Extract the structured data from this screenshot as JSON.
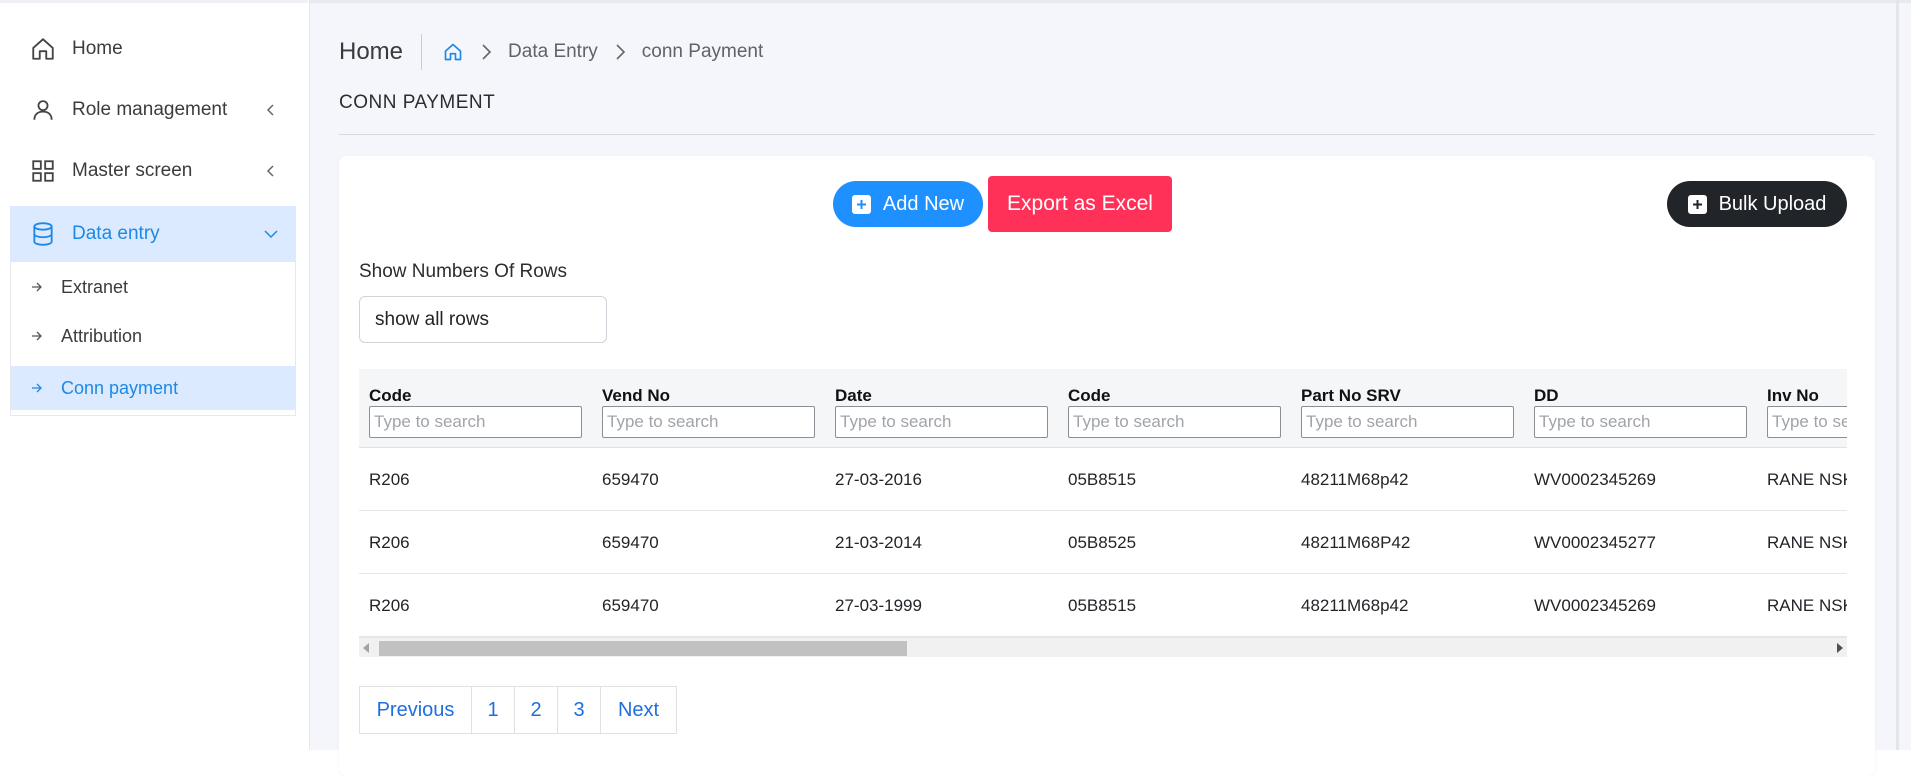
{
  "sidebar": {
    "items": [
      {
        "label": "Home",
        "icon": "home-icon"
      },
      {
        "label": "Role management",
        "icon": "user-icon"
      },
      {
        "label": "Master screen",
        "icon": "grid-icon"
      },
      {
        "label": "Data entry",
        "icon": "database-icon",
        "active": true
      }
    ],
    "subitems": [
      {
        "label": "Extranet"
      },
      {
        "label": "Attribution"
      },
      {
        "label": "Conn payment",
        "active": true
      }
    ]
  },
  "breadcrumb": {
    "title": "Home",
    "items": [
      "Data Entry",
      "conn Payment"
    ]
  },
  "page_title": "CONN PAYMENT",
  "toolbar": {
    "add_new": "Add New",
    "export": "Export as Excel",
    "bulk_upload": "Bulk Upload"
  },
  "rows_control": {
    "label": "Show Numbers Of Rows",
    "value": "show all rows"
  },
  "table": {
    "search_placeholder": "Type to search",
    "columns": [
      "Code",
      "Vend No",
      "Date",
      "Code",
      "Part No SRV",
      "DD",
      "Inv No"
    ],
    "rows": [
      [
        "R206",
        "659470",
        "27-03-2016",
        "05B8515",
        "48211M68p42",
        "WV0002345269",
        "RANE NSK STEERIN"
      ],
      [
        "R206",
        "659470",
        "21-03-2014",
        "05B8525",
        "48211M68P42",
        "WV0002345277",
        "RANE NSK STEERIN"
      ],
      [
        "R206",
        "659470",
        "27-03-1999",
        "05B8515",
        "48211M68p42",
        "WV0002345269",
        "RANE NSK STEERIN"
      ]
    ]
  },
  "pagination": {
    "previous": "Previous",
    "pages": [
      "1",
      "2",
      "3"
    ],
    "next": "Next"
  },
  "colors": {
    "accent": "#1e88e5",
    "add_button": "#1e90ff",
    "export_button": "#ff3158",
    "bulk_button": "#212529",
    "active_bg": "#dbeafe"
  }
}
